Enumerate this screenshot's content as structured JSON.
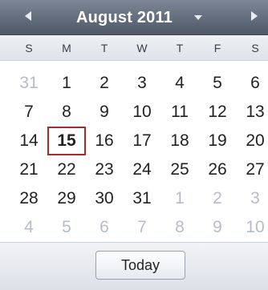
{
  "header": {
    "title": "August 2011",
    "prev_icon": "triangle-left-icon",
    "next_icon": "triangle-right-icon",
    "dropdown_icon": "caret-down-icon"
  },
  "weekdays": [
    "S",
    "M",
    "T",
    "W",
    "T",
    "F",
    "S"
  ],
  "weeks": [
    [
      {
        "d": "31",
        "o": true
      },
      {
        "d": "1"
      },
      {
        "d": "2"
      },
      {
        "d": "3"
      },
      {
        "d": "4"
      },
      {
        "d": "5"
      },
      {
        "d": "6"
      }
    ],
    [
      {
        "d": "7"
      },
      {
        "d": "8"
      },
      {
        "d": "9"
      },
      {
        "d": "10"
      },
      {
        "d": "11"
      },
      {
        "d": "12"
      },
      {
        "d": "13"
      }
    ],
    [
      {
        "d": "14"
      },
      {
        "d": "15",
        "today": true
      },
      {
        "d": "16"
      },
      {
        "d": "17"
      },
      {
        "d": "18"
      },
      {
        "d": "19"
      },
      {
        "d": "20"
      }
    ],
    [
      {
        "d": "21"
      },
      {
        "d": "22"
      },
      {
        "d": "23"
      },
      {
        "d": "24"
      },
      {
        "d": "25"
      },
      {
        "d": "26"
      },
      {
        "d": "27"
      }
    ],
    [
      {
        "d": "28"
      },
      {
        "d": "29"
      },
      {
        "d": "30"
      },
      {
        "d": "31"
      },
      {
        "d": "1",
        "o": true
      },
      {
        "d": "2",
        "o": true
      },
      {
        "d": "3",
        "o": true
      }
    ],
    [
      {
        "d": "4",
        "o": true
      },
      {
        "d": "5",
        "o": true
      },
      {
        "d": "6",
        "o": true
      },
      {
        "d": "7",
        "o": true
      },
      {
        "d": "8",
        "o": true
      },
      {
        "d": "9",
        "o": true
      },
      {
        "d": "10",
        "o": true
      }
    ]
  ],
  "footer": {
    "today_label": "Today"
  },
  "colors": {
    "header_bg": "#5f6877",
    "today_outline": "#a52b2b",
    "other_month_text": "#b7bcc4"
  }
}
